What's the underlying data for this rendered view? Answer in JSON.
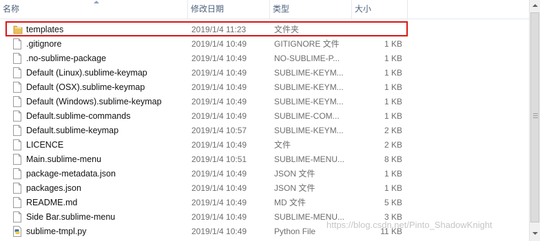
{
  "columns": {
    "name": "名称",
    "date": "修改日期",
    "type": "类型",
    "size": "大小"
  },
  "files": [
    {
      "name": "templates",
      "date": "2019/1/4 11:23",
      "type": "文件夹",
      "size": "",
      "icon": "folder-icon",
      "selected": true
    },
    {
      "name": ".gitignore",
      "date": "2019/1/4 10:49",
      "type": "GITIGNORE 文件",
      "size": "1 KB",
      "icon": "file-icon"
    },
    {
      "name": ".no-sublime-package",
      "date": "2019/1/4 10:49",
      "type": "NO-SUBLIME-P...",
      "size": "1 KB",
      "icon": "file-icon"
    },
    {
      "name": "Default (Linux).sublime-keymap",
      "date": "2019/1/4 10:49",
      "type": "SUBLIME-KEYM...",
      "size": "1 KB",
      "icon": "file-icon"
    },
    {
      "name": "Default (OSX).sublime-keymap",
      "date": "2019/1/4 10:49",
      "type": "SUBLIME-KEYM...",
      "size": "1 KB",
      "icon": "file-icon"
    },
    {
      "name": "Default (Windows).sublime-keymap",
      "date": "2019/1/4 10:49",
      "type": "SUBLIME-KEYM...",
      "size": "1 KB",
      "icon": "file-icon"
    },
    {
      "name": "Default.sublime-commands",
      "date": "2019/1/4 10:49",
      "type": "SUBLIME-COM...",
      "size": "1 KB",
      "icon": "file-icon"
    },
    {
      "name": "Default.sublime-keymap",
      "date": "2019/1/4 10:57",
      "type": "SUBLIME-KEYM...",
      "size": "2 KB",
      "icon": "file-icon"
    },
    {
      "name": "LICENCE",
      "date": "2019/1/4 10:49",
      "type": "文件",
      "size": "2 KB",
      "icon": "file-icon"
    },
    {
      "name": "Main.sublime-menu",
      "date": "2019/1/4 10:51",
      "type": "SUBLIME-MENU...",
      "size": "8 KB",
      "icon": "file-icon"
    },
    {
      "name": "package-metadata.json",
      "date": "2019/1/4 10:49",
      "type": "JSON 文件",
      "size": "1 KB",
      "icon": "file-icon"
    },
    {
      "name": "packages.json",
      "date": "2019/1/4 10:49",
      "type": "JSON 文件",
      "size": "1 KB",
      "icon": "file-icon"
    },
    {
      "name": "README.md",
      "date": "2019/1/4 10:49",
      "type": "MD 文件",
      "size": "5 KB",
      "icon": "file-icon"
    },
    {
      "name": "Side Bar.sublime-menu",
      "date": "2019/1/4 10:49",
      "type": "SUBLIME-MENU...",
      "size": "3 KB",
      "icon": "file-icon"
    },
    {
      "name": "sublime-tmpl.py",
      "date": "2019/1/4 10:49",
      "type": "Python File",
      "size": "11 KB",
      "icon": "python-file-icon"
    }
  ],
  "watermark": "https://blog.csdn.net/Pinto_ShadowKnight",
  "colors": {
    "highlight": "#d91a1a",
    "folder": "#e8c25a",
    "header_text": "#4c607a"
  }
}
